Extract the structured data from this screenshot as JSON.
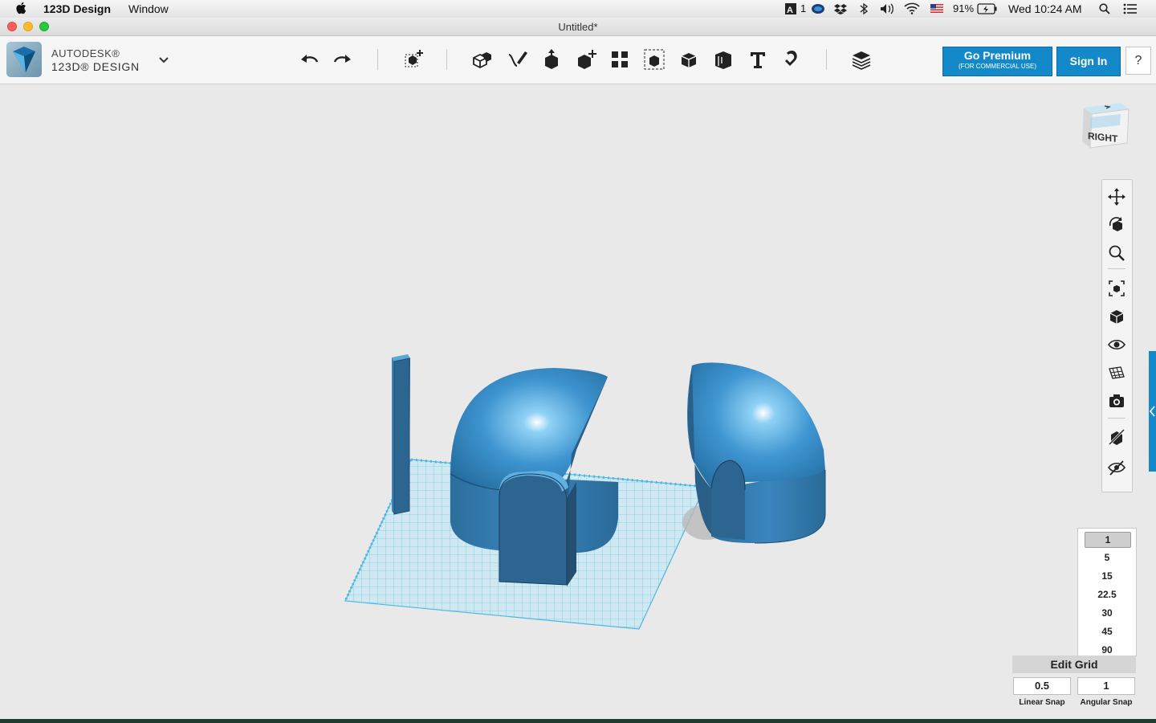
{
  "menubar": {
    "app_name": "123D Design",
    "menu_window": "Window",
    "tray": {
      "adobe_badge": "1",
      "battery": "91%",
      "clock": "Wed 10:24 AM"
    }
  },
  "window": {
    "title": "Untitled*"
  },
  "brand": {
    "line1": "AUTODESK®",
    "line2": "123D® DESIGN"
  },
  "toolbar": {
    "tools": [
      {
        "icon": "undo-icon"
      },
      {
        "icon": "redo-icon"
      },
      {
        "icon": "transform-icon"
      },
      {
        "icon": "primitives-icon"
      },
      {
        "icon": "sketch-icon"
      },
      {
        "icon": "construct-icon"
      },
      {
        "icon": "modify-icon"
      },
      {
        "icon": "pattern-icon"
      },
      {
        "icon": "grouping-icon"
      },
      {
        "icon": "combine-icon"
      },
      {
        "icon": "measure-icon"
      },
      {
        "icon": "text-icon"
      },
      {
        "icon": "snap-icon"
      },
      {
        "icon": "materials-icon"
      }
    ],
    "premium_label": "Go Premium",
    "premium_sub": "(FOR COMMERCIAL USE)",
    "signin_label": "Sign In",
    "help_label": "?"
  },
  "viewcube": {
    "face": "RIGHT"
  },
  "navbar": {
    "icons": [
      "pan-icon",
      "orbit-icon",
      "zoom-icon",
      "fit-icon",
      "view-mode-icon",
      "visibility-icon",
      "grid-toggle-icon",
      "screenshot-icon",
      "material-display-icon",
      "hide-icon"
    ]
  },
  "snap": {
    "angle_options": [
      "1",
      "5",
      "15",
      "22.5",
      "30",
      "45",
      "90"
    ],
    "selected": "1",
    "edit_grid": "Edit Grid",
    "linear_value": "0.5",
    "angular_value": "1",
    "linear_label": "Linear Snap",
    "angular_label": "Angular Snap"
  },
  "colors": {
    "accent": "#1389c9",
    "model_blue": "#3a86be",
    "grid": "#69c6e6"
  }
}
